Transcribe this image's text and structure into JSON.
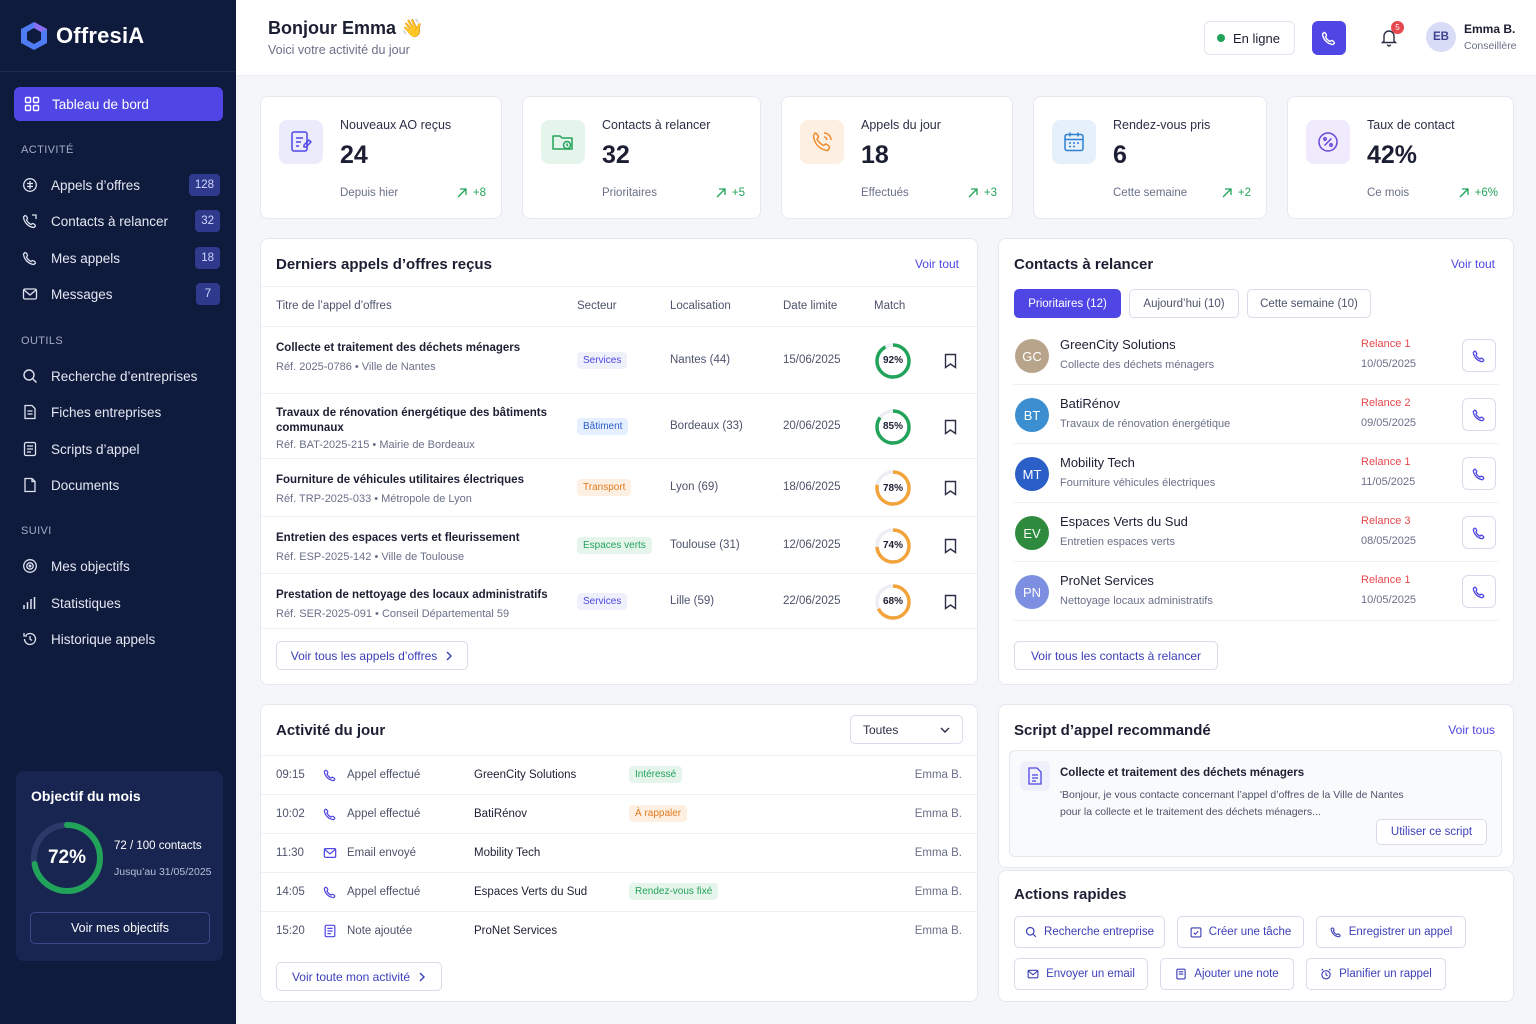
{
  "app": {
    "name": "OffresiA"
  },
  "sidebar": {
    "active": "Tableau de bord",
    "sections": [
      {
        "title": "ACTIVITÉ",
        "items": [
          {
            "label": "Appels d’offres",
            "badge": "128",
            "icon": "megaphone-icon"
          },
          {
            "label": "Contacts à relancer",
            "badge": "32",
            "icon": "phone-return-icon"
          },
          {
            "label": "Mes appels",
            "badge": "18",
            "icon": "phone-icon"
          },
          {
            "label": "Messages",
            "badge": "7",
            "icon": "mail-icon"
          }
        ]
      },
      {
        "title": "OUTILS",
        "items": [
          {
            "label": "Recherche d’entreprises",
            "icon": "search-icon"
          },
          {
            "label": "Fiches entreprises",
            "icon": "file-icon"
          },
          {
            "label": "Scripts d’appel",
            "icon": "script-icon"
          },
          {
            "label": "Documents",
            "icon": "document-icon"
          }
        ]
      },
      {
        "title": "SUIVI",
        "items": [
          {
            "label": "Mes objectifs",
            "icon": "target-icon"
          },
          {
            "label": "Statistiques",
            "icon": "bar-chart-icon"
          },
          {
            "label": "Historique appels",
            "icon": "history-icon"
          }
        ]
      }
    ],
    "goal": {
      "title": "Objectif du mois",
      "percent": "72%",
      "progress": 0.72,
      "count": "72 / 100 contacts",
      "until": "Jusqu’au 31/05/2025",
      "button": "Voir mes objectifs"
    }
  },
  "header": {
    "greeting": "Bonjour Emma 👋",
    "subtitle": "Voici votre activité du jour",
    "status": "En ligne",
    "notifications": "5",
    "user": {
      "initials": "EB",
      "name": "Emma B.",
      "role": "Conseillère"
    }
  },
  "stats": [
    {
      "label": "Nouveaux AO reçus",
      "value": "24",
      "foot": "Depuis hier",
      "delta": "+8",
      "icon": "file-edit-icon",
      "color": "#4f46e5",
      "bg": "#ecebfc"
    },
    {
      "label": "Contacts à relancer",
      "value": "32",
      "foot": "Prioritaires",
      "delta": "+5",
      "icon": "folder-clock-icon",
      "color": "#22a35a",
      "bg": "#e6f5ec"
    },
    {
      "label": "Appels du jour",
      "value": "18",
      "foot": "Effectués",
      "delta": "+3",
      "icon": "phone-incoming-icon",
      "color": "#f08c2e",
      "bg": "#fdf0e3"
    },
    {
      "label": "Rendez-vous pris",
      "value": "6",
      "foot": "Cette semaine",
      "delta": "+2",
      "icon": "calendar-icon",
      "color": "#2f80d0",
      "bg": "#e6f0fb"
    },
    {
      "label": "Taux de contact",
      "value": "42%",
      "foot": "Ce mois",
      "delta": "+6%",
      "icon": "percent-icon",
      "color": "#6a46d9",
      "bg": "#efeafc"
    }
  ],
  "tenders": {
    "title": "Derniers appels d’offres reçus",
    "link": "Voir tout",
    "columns": [
      "Titre de l’appel d’offres",
      "Secteur",
      "Localisation",
      "Date limite",
      "Match"
    ],
    "rows": [
      {
        "title": "Collecte et traitement des déchets ménagers",
        "ref": "Réf. 2025-0786  •  Ville de Nantes",
        "sector": "Services",
        "location": "Nantes (44)",
        "date": "15/06/2025",
        "match": "92%",
        "match_value": 0.92
      },
      {
        "title": "Travaux de rénovation énergétique des bâtiments communaux",
        "ref": "Réf. BAT-2025-215  •  Mairie de Bordeaux",
        "sector": "Bâtiment",
        "location": "Bordeaux (33)",
        "date": "20/06/2025",
        "match": "85%",
        "match_value": 0.85
      },
      {
        "title": "Fourniture de véhicules utilitaires électriques",
        "ref": "Réf. TRP-2025-033  •  Métropole de Lyon",
        "sector": "Transport",
        "location": "Lyon (69)",
        "date": "18/06/2025",
        "match": "78%",
        "match_value": 0.78
      },
      {
        "title": "Entretien des espaces verts et fleurissement",
        "ref": "Réf. ESP-2025-142  •  Ville de Toulouse",
        "sector": "Espaces verts",
        "location": "Toulouse (31)",
        "date": "12/06/2025",
        "match": "74%",
        "match_value": 0.74
      },
      {
        "title": "Prestation de nettoyage des locaux administratifs",
        "ref": "Réf. SER-2025-091  •  Conseil Départemental 59",
        "sector": "Services",
        "location": "Lille (59)",
        "date": "22/06/2025",
        "match": "68%",
        "match_value": 0.68
      }
    ],
    "footer_button": "Voir tous les appels d’offres"
  },
  "contacts": {
    "title": "Contacts à relancer",
    "link": "Voir tout",
    "tabs": [
      "Prioritaires (12)",
      "Aujourd’hui (10)",
      "Cette semaine (10)"
    ],
    "rows": [
      {
        "initials": "GC",
        "name": "GreenCity Solutions",
        "desc": "Collecte des déchets ménagers",
        "relance": "Relance 1",
        "date": "10/05/2025",
        "color": "#b8a48a"
      },
      {
        "initials": "BT",
        "name": "BatiRénov",
        "desc": "Travaux de rénovation énergétique",
        "relance": "Relance 2",
        "date": "09/05/2025",
        "color": "#3b8fd0"
      },
      {
        "initials": "MT",
        "name": "Mobility Tech",
        "desc": "Fourniture véhicules électriques",
        "relance": "Relance 1",
        "date": "11/05/2025",
        "color": "#2b5fc8"
      },
      {
        "initials": "EV",
        "name": "Espaces Verts du Sud",
        "desc": "Entretien espaces verts",
        "relance": "Relance 3",
        "date": "08/05/2025",
        "color": "#2e8b3e"
      },
      {
        "initials": "PN",
        "name": "ProNet Services",
        "desc": "Nettoyage locaux administratifs",
        "relance": "Relance 1",
        "date": "10/05/2025",
        "color": "#7d8fe0"
      }
    ],
    "footer_button": "Voir tous les contacts à relancer"
  },
  "activity": {
    "title": "Activité du jour",
    "filter": "Toutes",
    "rows": [
      {
        "time": "09:15",
        "type": "Appel effectué",
        "icon": "phone-icon",
        "who": "GreenCity Solutions",
        "tag": "Intéressé",
        "tag_color": "#22a35a",
        "tag_bg": "#e6f5ec",
        "user": "Emma B."
      },
      {
        "time": "10:02",
        "type": "Appel effectué",
        "icon": "phone-icon",
        "who": "BatiRénov",
        "tag": "À rappaler",
        "tag_color": "#e07a1f",
        "tag_bg": "#fdf0e3",
        "user": "Emma B."
      },
      {
        "time": "11:30",
        "type": "Email envoyé",
        "icon": "mail-icon",
        "who": "Mobility Tech",
        "tag": "",
        "user": "Emma B."
      },
      {
        "time": "14:05",
        "type": "Appel effectué",
        "icon": "phone-icon",
        "who": "Espaces Verts du Sud",
        "tag": "Rendez-vous fixé",
        "tag_color": "#22a35a",
        "tag_bg": "#e6f5ec",
        "user": "Emma B."
      },
      {
        "time": "15:20",
        "type": "Note ajoutée",
        "icon": "note-icon",
        "who": "ProNet Services",
        "tag": "",
        "user": "Emma B."
      }
    ],
    "footer_button": "Voir toute mon activité"
  },
  "script": {
    "title": "Script d’appel recommandé",
    "link": "Voir tous",
    "item_title": "Collecte et traitement des déchets ménagers",
    "item_text_1": "'Bonjour, je vous contacte concernant l’appel d’offres de la Ville de Nantes",
    "item_text_2": "pour la collecte et le traitement des déchets ménagers...",
    "button": "Utiliser ce script"
  },
  "quick_actions": {
    "title": "Actions rapides",
    "items": [
      "Recherche entreprise",
      "Créer une tâche",
      "Enregistrer un appel",
      "Envoyer un email",
      "Ajouter une note",
      "Planifier un rappel"
    ]
  },
  "colors": {
    "accent": "#4f46e5",
    "sidebar": "#0f1b3d",
    "success": "#22a35a",
    "danger": "#e5484d"
  }
}
